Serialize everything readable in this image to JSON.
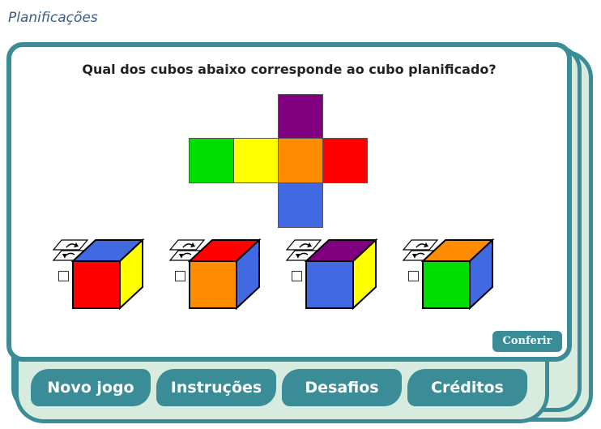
{
  "page": {
    "title": "Planificações"
  },
  "question": {
    "text": "Qual dos cubos abaixo corresponde ao cubo planificado?"
  },
  "net": {
    "top": "#800080",
    "row": [
      "#00dd00",
      "#ffff00",
      "#ff8c00",
      "#ff0000"
    ],
    "bottom": "#4169e1"
  },
  "options": [
    {
      "top": "#4169e1",
      "front": "#ff0000",
      "side": "#ffff00"
    },
    {
      "top": "#ff0000",
      "front": "#ff8c00",
      "side": "#4169e1"
    },
    {
      "top": "#800080",
      "front": "#4169e1",
      "side": "#ffff00"
    },
    {
      "top": "#ff8c00",
      "front": "#00dd00",
      "side": "#4169e1"
    }
  ],
  "actions": {
    "confirm": "Conferir"
  },
  "nav": {
    "tabs": [
      {
        "label": "Novo jogo"
      },
      {
        "label": "Instruções"
      },
      {
        "label": "Desafios"
      },
      {
        "label": "Créditos"
      }
    ]
  },
  "colors": {
    "frame": "#3a8c96",
    "frame_fill": "#d7ecdf",
    "title": "#3b5c8c"
  }
}
